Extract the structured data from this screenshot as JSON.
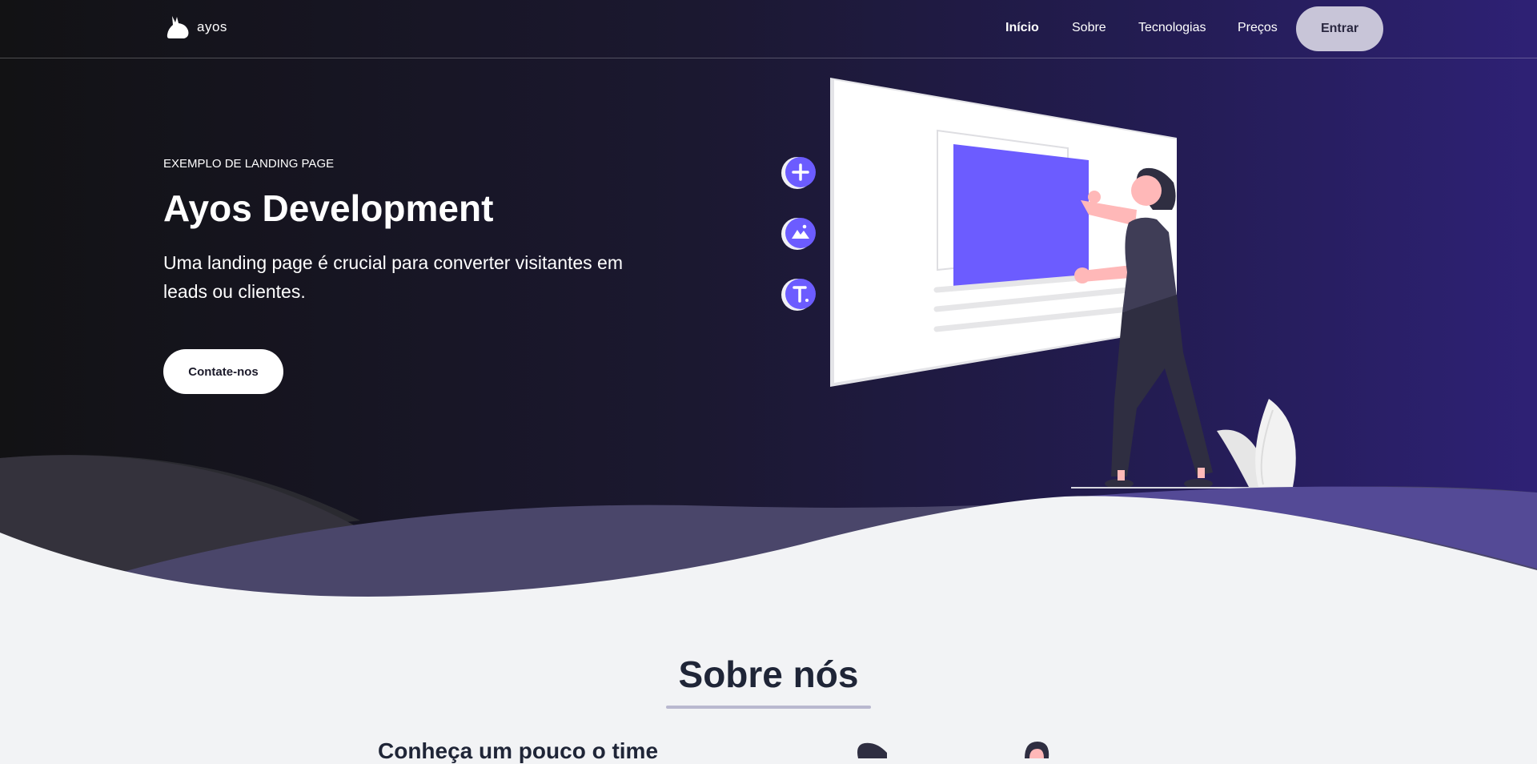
{
  "brand": {
    "name": "ayos"
  },
  "nav": {
    "links": [
      "Início",
      "Sobre",
      "Tecnologias",
      "Preços"
    ],
    "login_label": "Entrar"
  },
  "hero": {
    "eyebrow": "EXEMPLO DE LANDING PAGE",
    "title": "Ayos Development",
    "subtitle": "Uma landing page é crucial para converter visitantes em leads ou clientes.",
    "cta_label": "Contate-nos"
  },
  "about": {
    "title": "Sobre nós",
    "team_heading": "Conheça um pouco o time"
  },
  "colors": {
    "accent": "#6c5cff",
    "hero_dark": "#121214",
    "hero_purple": "#2e2175",
    "page_bg": "#f2f3f5",
    "login_button": "#c8c5d8"
  },
  "icons": [
    "bunny-logo-icon",
    "plus-icon",
    "image-icon",
    "text-icon"
  ]
}
